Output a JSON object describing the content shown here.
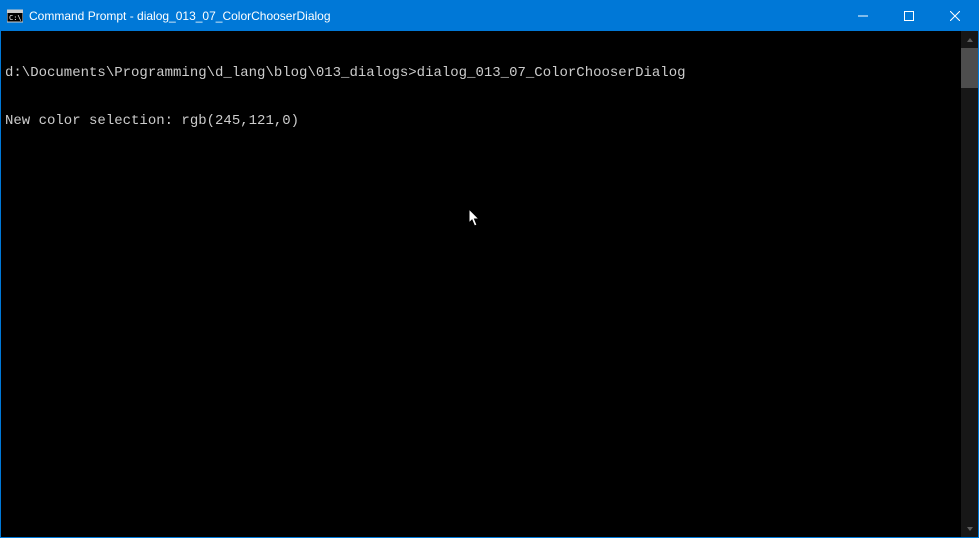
{
  "titlebar": {
    "title": "Command Prompt - dialog_013_07_ColorChooserDialog"
  },
  "terminal": {
    "lines": [
      "d:\\Documents\\Programming\\d_lang\\blog\\013_dialogs>dialog_013_07_ColorChooserDialog",
      "New color selection: rgb(245,121,0)"
    ]
  }
}
